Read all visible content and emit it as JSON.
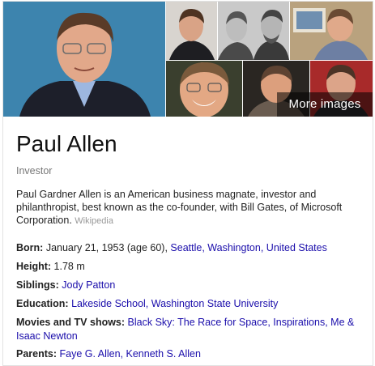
{
  "header": {
    "more_images_label": "More images"
  },
  "entity": {
    "name": "Paul Allen",
    "type": "Investor",
    "description": "Paul Gardner Allen is an American business magnate, investor and philanthropist, best known as the co-founder, with Bill Gates, of Microsoft Corporation.",
    "source": "Wikipedia"
  },
  "facts": {
    "born": {
      "label": "Born:",
      "text": "January 21, 1953 (age 60),",
      "places": [
        "Seattle,",
        "Washington,",
        "United States"
      ]
    },
    "height": {
      "label": "Height:",
      "text": "1.78 m"
    },
    "siblings": {
      "label": "Siblings:",
      "links": [
        "Jody Patton"
      ]
    },
    "education": {
      "label": "Education:",
      "links": [
        "Lakeside School,",
        "Washington State University"
      ]
    },
    "movies": {
      "label": "Movies and TV shows:",
      "links": [
        "Black Sky: The Race for Space,",
        "Inspirations,",
        "Me & Isaac Newton"
      ]
    },
    "parents": {
      "label": "Parents:",
      "links": [
        "Faye G. Allen,",
        "Kenneth S. Allen"
      ]
    }
  },
  "colors": {
    "link": "#1a0dab",
    "muted": "#777777",
    "overlay": "rgba(0,0,0,0.55)"
  }
}
